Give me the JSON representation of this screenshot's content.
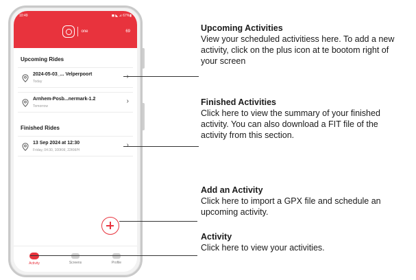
{
  "phone": {
    "status_time": "10:49",
    "status_right": "◼ ◣ ⊿ 67%▮",
    "logo_text": "one",
    "header_right": "69",
    "upcoming_title": "Upcoming Rides",
    "upcoming": [
      {
        "title": "2024-05-03_... Velperpoort",
        "subtitle": "Today"
      },
      {
        "title": "Arnhem-Posb...nermark-1.2",
        "subtitle": "Tomorrow"
      }
    ],
    "finished_title": "Finished Rides",
    "finished": [
      {
        "title": "13 Sep 2024 at 12:30",
        "subtitle": "Friday, 04:30, 100KM, 22KM/H"
      }
    ],
    "tabs": [
      {
        "label": "Activity",
        "icon": "activity-icon"
      },
      {
        "label": "Screens",
        "icon": "screens-icon"
      },
      {
        "label": "Profile",
        "icon": "profile-icon"
      }
    ]
  },
  "notes": {
    "upcoming": {
      "title": "Upcoming Activities",
      "body": "View your scheduled activitiess here. To add a new activity, click on the plus icon at te bootom right of your screen"
    },
    "finished": {
      "title": "Finished Activities",
      "body": "Click here to view the summary of your finished activity. You can also download a FIT file of the activity from this section."
    },
    "add": {
      "title": "Add an Activity",
      "body": "Click here to import a GPX file and schedule an upcoming activity."
    },
    "activity": {
      "title": "Activity",
      "body": "Click here to view your activities."
    }
  },
  "colors": {
    "accent": "#e8333d"
  }
}
